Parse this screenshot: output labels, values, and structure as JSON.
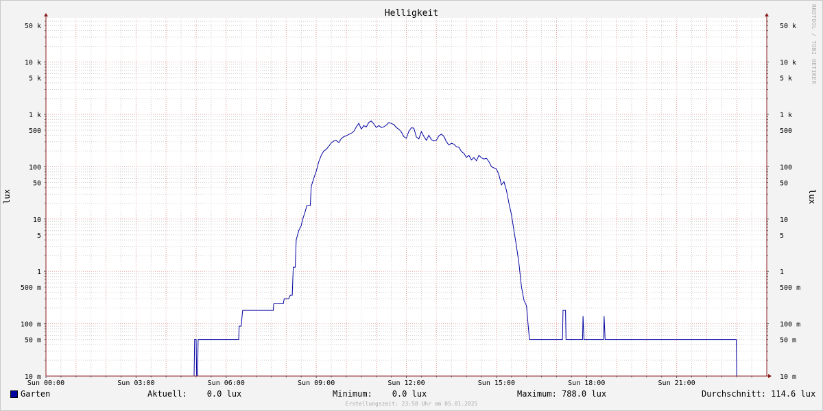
{
  "chart_data": {
    "type": "line",
    "title": "Helligkeit",
    "ylabel": "lux",
    "y_scale": "log",
    "ylim": [
      0.01,
      70000
    ],
    "xlim": [
      "00:00",
      "24:00"
    ],
    "y_ticks": [
      {
        "value": 50000,
        "label": "50 k"
      },
      {
        "value": 10000,
        "label": "10 k"
      },
      {
        "value": 5000,
        "label": "5 k"
      },
      {
        "value": 1000,
        "label": "1 k"
      },
      {
        "value": 500,
        "label": "500"
      },
      {
        "value": 100,
        "label": "100"
      },
      {
        "value": 50,
        "label": "50"
      },
      {
        "value": 10,
        "label": "10"
      },
      {
        "value": 5,
        "label": "5"
      },
      {
        "value": 1,
        "label": "1"
      },
      {
        "value": 0.5,
        "label": "500 m"
      },
      {
        "value": 0.1,
        "label": "100 m"
      },
      {
        "value": 0.05,
        "label": "50 m"
      },
      {
        "value": 0.01,
        "label": "10 m"
      }
    ],
    "x_ticks": [
      {
        "value": "00:00",
        "label": "Sun 00:00"
      },
      {
        "value": "03:00",
        "label": "Sun 03:00"
      },
      {
        "value": "06:00",
        "label": "Sun 06:00"
      },
      {
        "value": "09:00",
        "label": "Sun 09:00"
      },
      {
        "value": "12:00",
        "label": "Sun 12:00"
      },
      {
        "value": "15:00",
        "label": "Sun 15:00"
      },
      {
        "value": "18:00",
        "label": "Sun 18:00"
      },
      {
        "value": "21:00",
        "label": "Sun 21:00"
      }
    ],
    "grid": true,
    "series": [
      {
        "name": "Garten",
        "color": "#0000a0",
        "points": [
          [
            "00:00",
            0.01
          ],
          [
            "04:56",
            0.01
          ],
          [
            "04:57",
            0.05
          ],
          [
            "05:00",
            0.05
          ],
          [
            "05:01",
            0.01
          ],
          [
            "05:03",
            0.01
          ],
          [
            "05:04",
            0.05
          ],
          [
            "06:25",
            0.05
          ],
          [
            "06:26",
            0.09
          ],
          [
            "06:30",
            0.09
          ],
          [
            "06:33",
            0.18
          ],
          [
            "07:34",
            0.18
          ],
          [
            "07:35",
            0.24
          ],
          [
            "07:54",
            0.24
          ],
          [
            "07:56",
            0.3
          ],
          [
            "08:05",
            0.3
          ],
          [
            "08:08",
            0.35
          ],
          [
            "08:12",
            0.35
          ],
          [
            "08:14",
            1.2
          ],
          [
            "08:18",
            1.2
          ],
          [
            "08:20",
            4.0
          ],
          [
            "08:25",
            6.0
          ],
          [
            "08:30",
            7.5
          ],
          [
            "08:33",
            10
          ],
          [
            "08:38",
            14
          ],
          [
            "08:41",
            18
          ],
          [
            "08:48",
            18
          ],
          [
            "08:50",
            42
          ],
          [
            "08:55",
            60
          ],
          [
            "09:00",
            82
          ],
          [
            "09:05",
            125
          ],
          [
            "09:10",
            165
          ],
          [
            "09:15",
            200
          ],
          [
            "09:20",
            215
          ],
          [
            "09:25",
            245
          ],
          [
            "09:30",
            285
          ],
          [
            "09:35",
            310
          ],
          [
            "09:40",
            318
          ],
          [
            "09:45",
            290
          ],
          [
            "09:50",
            345
          ],
          [
            "09:55",
            375
          ],
          [
            "10:00",
            390
          ],
          [
            "10:05",
            415
          ],
          [
            "10:10",
            435
          ],
          [
            "10:15",
            475
          ],
          [
            "10:20",
            575
          ],
          [
            "10:25",
            675
          ],
          [
            "10:30",
            525
          ],
          [
            "10:35",
            610
          ],
          [
            "10:40",
            575
          ],
          [
            "10:45",
            700
          ],
          [
            "10:50",
            745
          ],
          [
            "10:55",
            658
          ],
          [
            "11:00",
            560
          ],
          [
            "11:05",
            610
          ],
          [
            "11:10",
            560
          ],
          [
            "11:15",
            580
          ],
          [
            "11:20",
            625
          ],
          [
            "11:25",
            700
          ],
          [
            "11:30",
            670
          ],
          [
            "11:35",
            640
          ],
          [
            "11:40",
            560
          ],
          [
            "11:45",
            520
          ],
          [
            "11:50",
            460
          ],
          [
            "11:55",
            375
          ],
          [
            "12:00",
            350
          ],
          [
            "12:05",
            475
          ],
          [
            "12:10",
            555
          ],
          [
            "12:15",
            545
          ],
          [
            "12:20",
            370
          ],
          [
            "12:25",
            340
          ],
          [
            "12:30",
            470
          ],
          [
            "12:35",
            380
          ],
          [
            "12:40",
            320
          ],
          [
            "12:45",
            400
          ],
          [
            "12:50",
            330
          ],
          [
            "12:55",
            310
          ],
          [
            "13:00",
            320
          ],
          [
            "13:05",
            390
          ],
          [
            "13:10",
            420
          ],
          [
            "13:15",
            380
          ],
          [
            "13:20",
            300
          ],
          [
            "13:25",
            260
          ],
          [
            "13:30",
            280
          ],
          [
            "13:35",
            270
          ],
          [
            "13:40",
            240
          ],
          [
            "13:45",
            235
          ],
          [
            "13:50",
            195
          ],
          [
            "13:55",
            180
          ],
          [
            "14:00",
            150
          ],
          [
            "14:05",
            165
          ],
          [
            "14:10",
            135
          ],
          [
            "14:15",
            150
          ],
          [
            "14:20",
            130
          ],
          [
            "14:25",
            165
          ],
          [
            "14:30",
            148
          ],
          [
            "14:35",
            140
          ],
          [
            "14:40",
            145
          ],
          [
            "14:45",
            125
          ],
          [
            "14:50",
            100
          ],
          [
            "14:55",
            95
          ],
          [
            "15:00",
            90
          ],
          [
            "15:05",
            70
          ],
          [
            "15:10",
            45
          ],
          [
            "15:15",
            52
          ],
          [
            "15:20",
            35
          ],
          [
            "15:25",
            20
          ],
          [
            "15:30",
            12
          ],
          [
            "15:35",
            6
          ],
          [
            "15:40",
            3
          ],
          [
            "15:45",
            1.4
          ],
          [
            "15:50",
            0.5
          ],
          [
            "15:55",
            0.28
          ],
          [
            "16:00",
            0.22
          ],
          [
            "16:03",
            0.1
          ],
          [
            "16:06",
            0.05
          ],
          [
            "16:09",
            0.05
          ],
          [
            "17:12",
            0.05
          ],
          [
            "17:13",
            0.18
          ],
          [
            "17:18",
            0.18
          ],
          [
            "17:19",
            0.05
          ],
          [
            "17:52",
            0.05
          ],
          [
            "17:53",
            0.14
          ],
          [
            "17:55",
            0.05
          ],
          [
            "18:34",
            0.05
          ],
          [
            "18:35",
            0.14
          ],
          [
            "18:37",
            0.05
          ],
          [
            "22:59",
            0.05
          ],
          [
            "23:00",
            0.01
          ],
          [
            "24:00",
            0.01
          ]
        ]
      }
    ],
    "legend": {
      "series_label": "Garten",
      "current": "Aktuell:    0.0 lux",
      "minimum": "Minimum:    0.0 lux",
      "maximum": "Maximum: 788.0 lux",
      "average": "Durchschnitt: 114.6 lux"
    },
    "footer": "Erstellungszeit: 23:58 Uhr am 05.01.2025",
    "watermark": "RRDTOOL / TOBI OETIKER",
    "colors": {
      "line": "#0000a0",
      "major_grid": "#e8a0a0",
      "minor_grid": "#cfcfcf",
      "axis": "#8b1a1a",
      "plot_bg": "#ffffff",
      "frame_bg": "#f3f3f3"
    }
  }
}
